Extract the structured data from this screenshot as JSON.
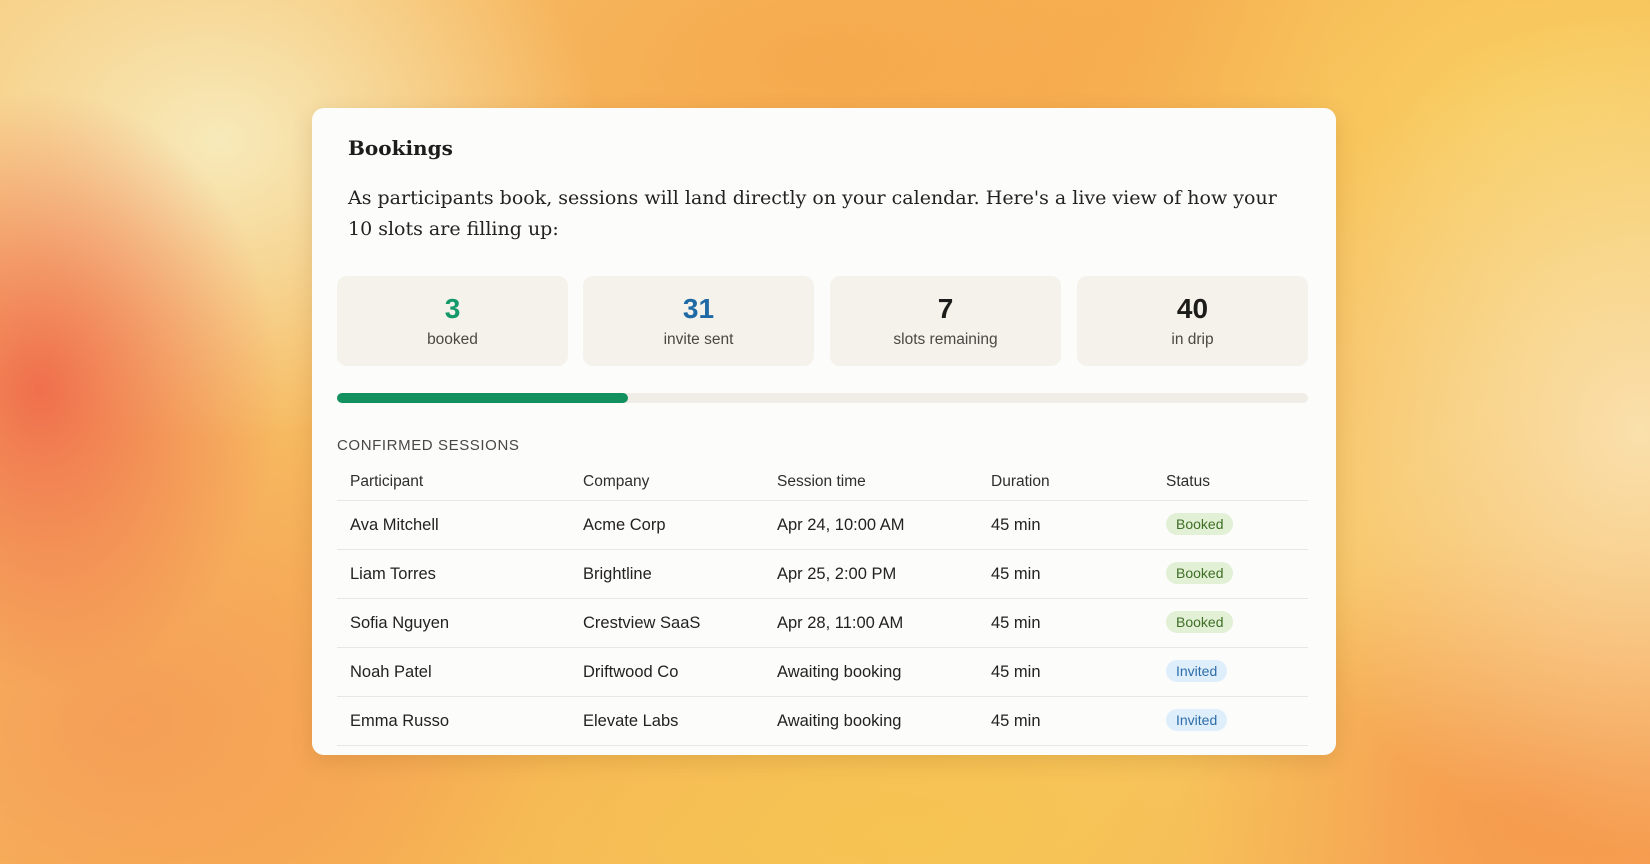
{
  "card": {
    "title": "Bookings",
    "intro": "As participants book, sessions will land directly on your calendar. Here's a live view of how your 10 slots are filling up:"
  },
  "stats": [
    {
      "value": "3",
      "label": "booked",
      "color": "#13996a"
    },
    {
      "value": "31",
      "label": "invite sent",
      "color": "#1f6aa5"
    },
    {
      "value": "7",
      "label": "slots remaining",
      "color": "#1c1c1a"
    },
    {
      "value": "40",
      "label": "in drip",
      "color": "#1c1c1a"
    }
  ],
  "progress": {
    "fraction": 0.3,
    "color": "#12915f"
  },
  "section": {
    "label": "CONFIRMED SESSIONS"
  },
  "table": {
    "headers": [
      "Participant",
      "Company",
      "Session time",
      "Duration",
      "Status"
    ],
    "rows": [
      [
        "Ava Mitchell",
        "Acme Corp",
        "Apr 24, 10:00 AM",
        "45 min",
        "Booked"
      ],
      [
        "Liam Torres",
        "Brightline",
        "Apr 25, 2:00 PM",
        "45 min",
        "Booked"
      ],
      [
        "Sofia Nguyen",
        "Crestview SaaS",
        "Apr 28, 11:00 AM",
        "45 min",
        "Booked"
      ],
      [
        "Noah Patel",
        "Driftwood Co",
        "Awaiting booking",
        "45 min",
        "Invited"
      ],
      [
        "Emma Russo",
        "Elevate Labs",
        "Awaiting booking",
        "45 min",
        "Invited"
      ]
    ]
  },
  "status_colors": {
    "Booked": {
      "bg": "#e2f0d5",
      "fg": "#3f6e26"
    },
    "Invited": {
      "bg": "#dfeefb",
      "fg": "#2c6da9"
    }
  }
}
